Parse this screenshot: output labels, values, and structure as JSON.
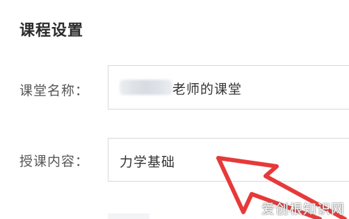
{
  "panel": {
    "title": "课程设置"
  },
  "form": {
    "class_name_label": "课堂名称：",
    "class_name_value": "老师的课堂",
    "content_label": "授课内容：",
    "content_value": "力学基础"
  },
  "annotation": {
    "arrow_color": "#e63a3a"
  },
  "watermark": {
    "text": "爱创根知识网"
  }
}
